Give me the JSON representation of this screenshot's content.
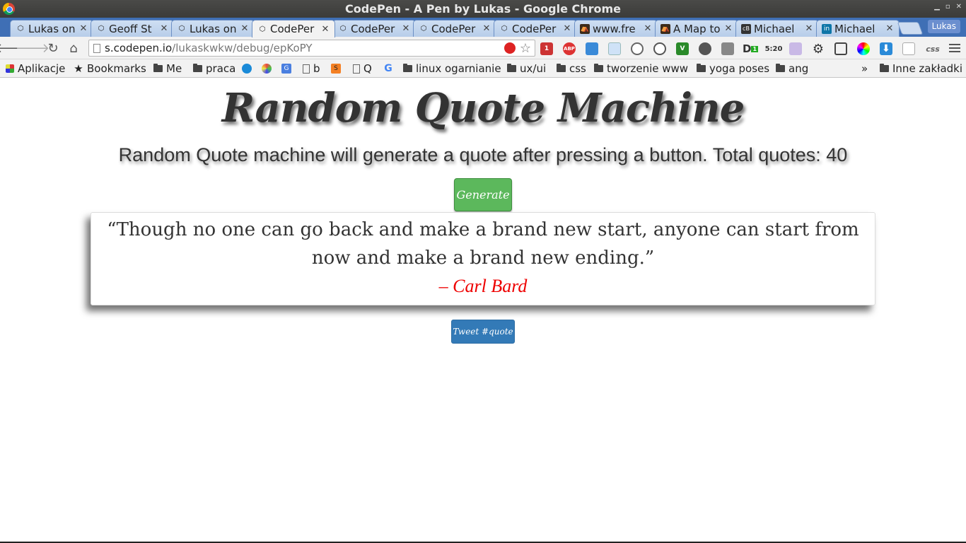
{
  "window": {
    "title": "CodePen - A Pen by Lukas - Google Chrome"
  },
  "tabs": [
    {
      "title": "Lukas on",
      "icon": "codepen-icon"
    },
    {
      "title": "Geoff St",
      "icon": "codepen-icon"
    },
    {
      "title": "Lukas on",
      "icon": "codepen-icon"
    },
    {
      "title": "CodePer",
      "icon": "codepen-icon",
      "active": true
    },
    {
      "title": "CodePer",
      "icon": "codepen-icon"
    },
    {
      "title": "CodePer",
      "icon": "codepen-icon"
    },
    {
      "title": "CodePer",
      "icon": "codepen-icon"
    },
    {
      "title": "www.fre",
      "icon": "freecodecamp-icon"
    },
    {
      "title": "A Map to",
      "icon": "freecodecamp-icon"
    },
    {
      "title": "Michael",
      "icon": "codebase-icon"
    },
    {
      "title": "Michael",
      "icon": "linkedin-icon"
    }
  ],
  "profile": {
    "name": "Lukas"
  },
  "address": {
    "host": "s.codepen.io",
    "path": "/lukaskwkw/debug/epKoPY"
  },
  "bookmarks": [
    {
      "label": "Aplikacje",
      "icon": "apps-grid-icon"
    },
    {
      "label": "Bookmarks",
      "icon": "star-icon"
    },
    {
      "label": "Me",
      "icon": "folder-icon"
    },
    {
      "label": "praca",
      "icon": "folder-icon"
    },
    {
      "label": "",
      "icon": "chat-icon"
    },
    {
      "label": "",
      "icon": "pinwheel-icon"
    },
    {
      "label": "",
      "icon": "translate-icon"
    },
    {
      "label": "b",
      "icon": "page-icon"
    },
    {
      "label": "",
      "icon": "stackoverflow-icon"
    },
    {
      "label": "Q",
      "icon": "page-icon"
    },
    {
      "label": "",
      "icon": "google-icon"
    },
    {
      "label": "linux ogarnianie",
      "icon": "folder-icon"
    },
    {
      "label": "ux/ui",
      "icon": "folder-icon"
    },
    {
      "label": "css",
      "icon": "folder-icon"
    },
    {
      "label": "tworzenie www",
      "icon": "folder-icon"
    },
    {
      "label": "yoga poses",
      "icon": "folder-icon"
    },
    {
      "label": "ang",
      "icon": "folder-icon"
    }
  ],
  "bookmarks_overflow": "»",
  "other_bookmarks": "Inne zakładki",
  "extensions": {
    "badge_one": "1",
    "abp": "ABP",
    "badge_d": "1",
    "clock_text": "5:20",
    "css_label": "css"
  },
  "page": {
    "title": "Random Quote Machine",
    "subtitle": "Random Quote machine will generate a quote after pressing a button. Total quotes: 40",
    "generate_label": "Generate",
    "quote": "“Though no one can go back and make a brand new start, anyone can start from now and make a brand new ending.”",
    "author": "– Carl Bard",
    "tweet_label": "Tweet #quote"
  },
  "colors": {
    "generate": "#5cb85c",
    "tweet": "#337ab7",
    "author": "#e00000"
  }
}
